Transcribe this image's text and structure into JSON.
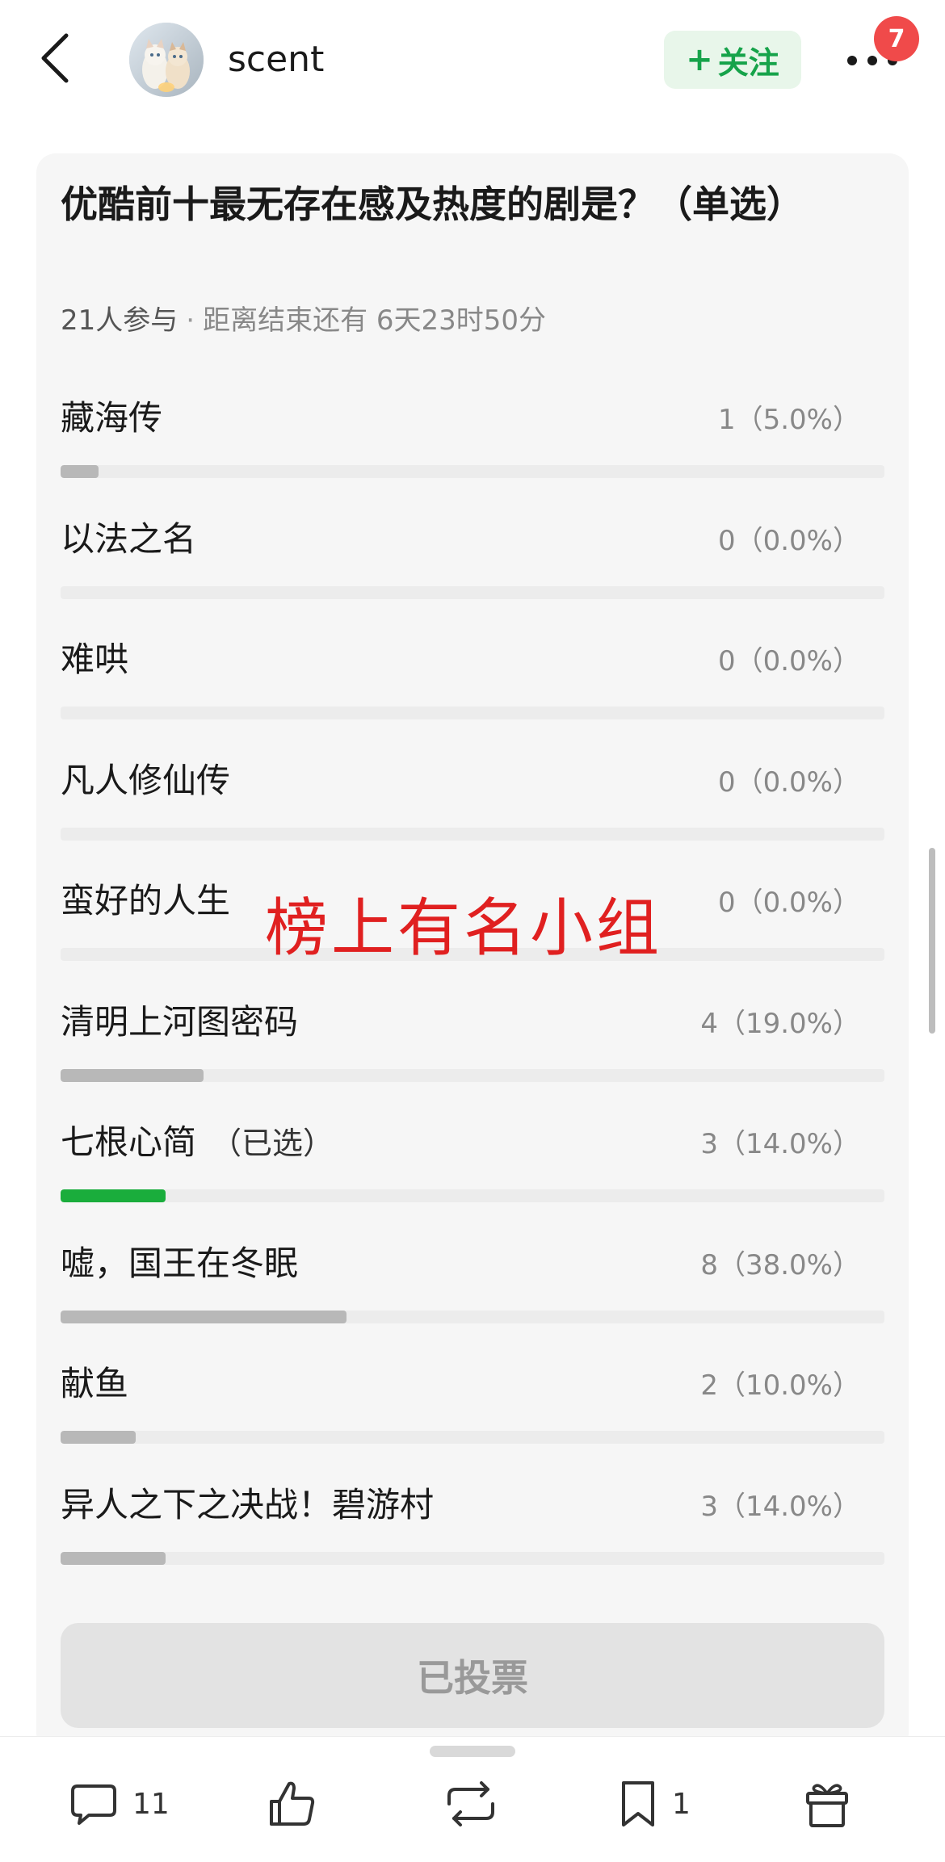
{
  "header": {
    "back_icon": "chevron-left-icon",
    "avatar_icon": "avatar-cats",
    "username": "scent",
    "follow_label": "关注",
    "follow_plus": "+",
    "more_icon": "more-dots-icon",
    "notification_count": "7",
    "follow_color": "#16a34a",
    "badge_color": "#f04a4a"
  },
  "poll": {
    "title": "优酷前十最无存在感及热度的剧是？（单选）",
    "participants": "21人参与",
    "separator": "·",
    "countdown": "距离结束还有 6天23时50分",
    "options": [
      {
        "label": "藏海传",
        "result": "1（5.0%）",
        "fraction": 0.05,
        "selected": false
      },
      {
        "label": "以法之名",
        "result": "0（0.0%）",
        "fraction": 0.0,
        "selected": false
      },
      {
        "label": "难哄",
        "result": "0（0.0%）",
        "fraction": 0.0,
        "selected": false
      },
      {
        "label": "凡人修仙传",
        "result": "0（0.0%）",
        "fraction": 0.0,
        "selected": false
      },
      {
        "label": "蛮好的人生",
        "result": "0（0.0%）",
        "fraction": 0.0,
        "selected": false
      },
      {
        "label": "清明上河图密码",
        "result": "4（19.0%）",
        "fraction": 0.19,
        "selected": false
      },
      {
        "label": "七根心简",
        "selected_tag": "（已选）",
        "result": "3（14.0%）",
        "fraction": 0.14,
        "selected": true
      },
      {
        "label": "嘘，国王在冬眠",
        "result": "8（38.0%）",
        "fraction": 0.38,
        "selected": false
      },
      {
        "label": "献鱼",
        "result": "2（10.0%）",
        "fraction": 0.1,
        "selected": false
      },
      {
        "label": "异人之下之决战！碧游村",
        "result": "3（14.0%）",
        "fraction": 0.14,
        "selected": false
      }
    ],
    "voted_label": "已投票",
    "selected_color": "#1aad3c"
  },
  "overlay": {
    "watermark_text": "榜上有名小组",
    "watermark_color": "#e02020"
  },
  "bottom_bar": {
    "comment_icon": "comment-icon",
    "comment_count": "11",
    "like_icon": "thumbs-up-icon",
    "repost_icon": "repost-icon",
    "favorite_icon": "bookmark-icon",
    "favorite_count": "1",
    "gift_icon": "gift-icon"
  }
}
